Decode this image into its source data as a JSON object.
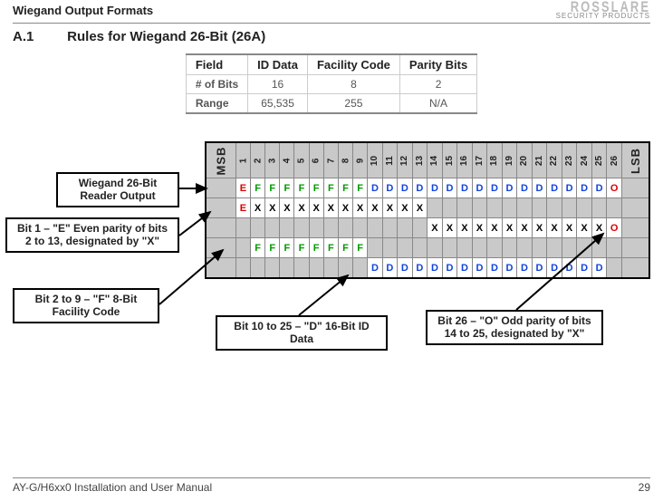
{
  "header": {
    "title_left": "Wiegand Output Formats",
    "brand_top": "ROSSLARE",
    "brand_bottom": "SECURITY PRODUCTS"
  },
  "section": {
    "number": "A.1",
    "title": "Rules for Wiegand 26-Bit (26A)"
  },
  "table": {
    "headers": [
      "Field",
      "ID Data",
      "Facility Code",
      "Parity Bits"
    ],
    "row_bits": [
      "# of Bits",
      "16",
      "8",
      "2"
    ],
    "row_range": [
      "Range",
      "65,535",
      "255",
      "N/A"
    ]
  },
  "diagram": {
    "msb": "MSB",
    "lsb": "LSB",
    "bit_numbers": [
      "1",
      "2",
      "3",
      "4",
      "5",
      "6",
      "7",
      "8",
      "9",
      "10",
      "11",
      "12",
      "13",
      "14",
      "15",
      "16",
      "17",
      "18",
      "19",
      "20",
      "21",
      "22",
      "23",
      "24",
      "25",
      "26"
    ],
    "row1": [
      "E",
      "F",
      "F",
      "F",
      "F",
      "F",
      "F",
      "F",
      "F",
      "D",
      "D",
      "D",
      "D",
      "D",
      "D",
      "D",
      "D",
      "D",
      "D",
      "D",
      "D",
      "D",
      "D",
      "D",
      "D",
      "O"
    ],
    "row2": [
      "E",
      "X",
      "X",
      "X",
      "X",
      "X",
      "X",
      "X",
      "X",
      "X",
      "X",
      "X",
      "X",
      "",
      "",
      "",
      "",
      "",
      "",
      "",
      "",
      "",
      "",
      "",
      "",
      ""
    ],
    "row3": [
      "",
      "",
      "",
      "",
      "",
      "",
      "",
      "",
      "",
      "",
      "",
      "",
      "",
      "X",
      "X",
      "X",
      "X",
      "X",
      "X",
      "X",
      "X",
      "X",
      "X",
      "X",
      "X",
      "O"
    ],
    "row4": [
      "",
      "F",
      "F",
      "F",
      "F",
      "F",
      "F",
      "F",
      "F",
      "",
      "",
      "",
      "",
      "",
      "",
      "",
      "",
      "",
      "",
      "",
      "",
      "",
      "",
      "",
      "",
      ""
    ],
    "row5": [
      "",
      "",
      "",
      "",
      "",
      "",
      "",
      "",
      "",
      "D",
      "D",
      "D",
      "D",
      "D",
      "D",
      "D",
      "D",
      "D",
      "D",
      "D",
      "D",
      "D",
      "D",
      "D",
      "D",
      ""
    ]
  },
  "callouts": {
    "c1": "Wiegand 26-Bit Reader Output",
    "c2": "Bit 1 – \"E\" Even parity of bits 2 to 13, designated by \"X\"",
    "c3": "Bit 2 to 9 – \"F\" 8-Bit Facility Code",
    "c4": "Bit 10 to 25 – \"D\" 16-Bit ID Data",
    "c5": "Bit 26 – \"O\" Odd parity of bits 14 to 25, designated by \"X\""
  },
  "footer": {
    "left": "AY-G/H6xx0 Installation and User Manual",
    "right": "29"
  }
}
